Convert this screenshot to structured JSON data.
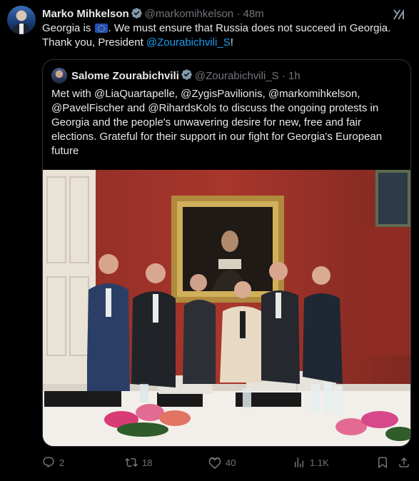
{
  "author": {
    "name": "Marko Mihkelson",
    "handle": "@markomihkelson",
    "separator": "·",
    "time": "48m"
  },
  "tweet": {
    "text_prefix": "Georgia is ",
    "text_after_flag": ". We must ensure that Russia does not succeed in Georgia.",
    "text_line2": "Thank you, President ",
    "mention": "@Zourabichvili_S",
    "text_end": "!"
  },
  "quote": {
    "name": "Salome Zourabichvili",
    "handle": "@Zourabichvili_S",
    "separator": "·",
    "time": "1h",
    "text": "Met with @LiaQuartapelle, @ZygisPavilionis, @markomihkelson, @PavelFischer and @RihardsKols to discuss the ongoing protests in Georgia and the people's unwavering desire for new, free and fair elections. Grateful for their support in our fight for Georgia's European future"
  },
  "actions": {
    "replies": "2",
    "reposts": "18",
    "likes": "40",
    "views": "1.1K"
  },
  "colors": {
    "background": "#000000",
    "text": "#e7e9ea",
    "muted": "#71767b",
    "link": "#1d9bf0",
    "verified": "#829aab",
    "border": "#2f3336"
  },
  "icons": [
    "verified-badge-icon",
    "grok-icon",
    "eu-flag-emoji",
    "reply-icon",
    "repost-icon",
    "like-icon",
    "views-icon",
    "bookmark-icon",
    "share-icon"
  ]
}
